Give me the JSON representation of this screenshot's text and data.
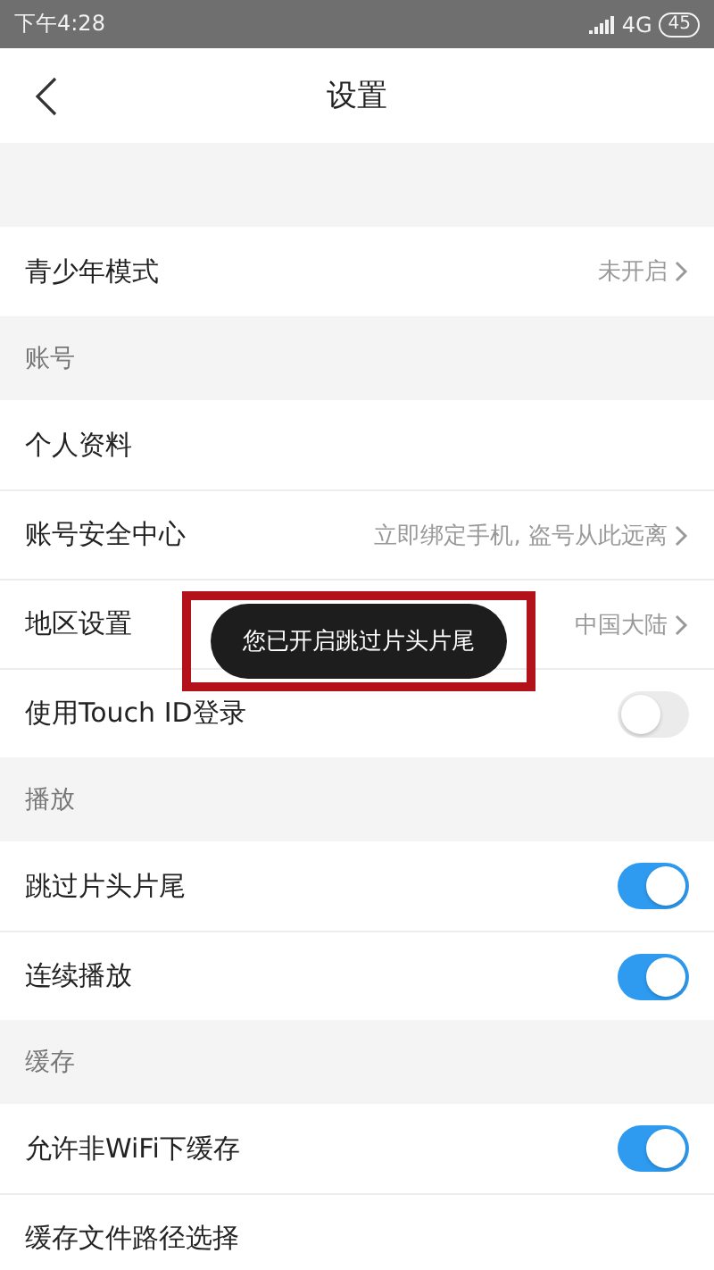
{
  "status_bar": {
    "time": "下午4:28",
    "network": "4G",
    "battery": "45"
  },
  "header": {
    "title": "设置"
  },
  "sections": [
    {
      "rows": [
        {
          "kind": "link",
          "label": "青少年模式",
          "value": "未开启"
        }
      ]
    },
    {
      "title": "账号",
      "rows": [
        {
          "kind": "plain",
          "label": "个人资料"
        },
        {
          "kind": "link",
          "label": "账号安全中心",
          "value": "立即绑定手机, 盗号从此远离"
        },
        {
          "kind": "link",
          "label": "地区设置",
          "value": "中国大陆"
        },
        {
          "kind": "toggle",
          "label": "使用Touch ID登录",
          "on": false
        }
      ]
    },
    {
      "title": "播放",
      "rows": [
        {
          "kind": "toggle",
          "label": "跳过片头片尾",
          "on": true
        },
        {
          "kind": "toggle",
          "label": "连续播放",
          "on": true
        }
      ]
    },
    {
      "title": "缓存",
      "rows": [
        {
          "kind": "toggle",
          "label": "允许非WiFi下缓存",
          "on": true
        },
        {
          "kind": "plain",
          "label": "缓存文件路径选择"
        }
      ]
    }
  ],
  "toast": {
    "text": "您已开启跳过片头片尾",
    "highlighted": true
  }
}
